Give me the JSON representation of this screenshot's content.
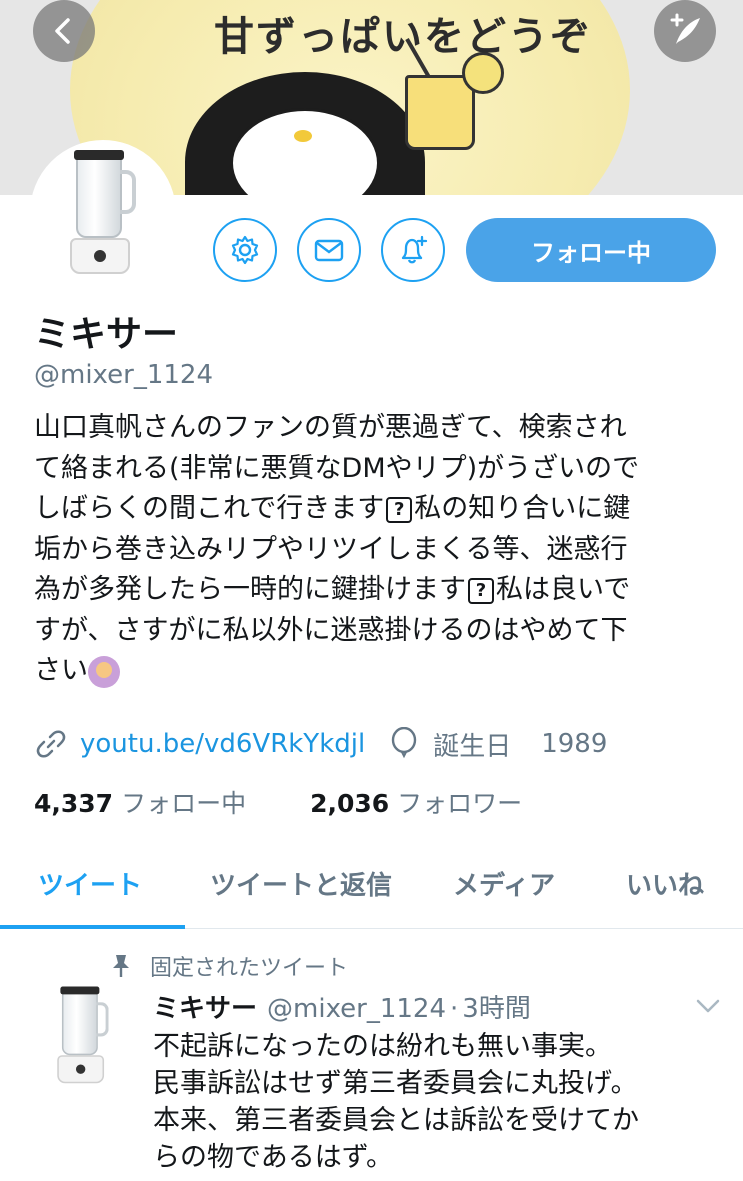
{
  "header": {
    "banner_text": "甘ずっぱいをどうぞ",
    "back_icon": "chevron-left-icon",
    "compose_icon": "feather-plus-icon"
  },
  "profile": {
    "name": "ミキサー",
    "handle": "@mixer_1124",
    "bio_lines": [
      "山口真帆さんのファンの質が悪過ぎて、検索され",
      "て絡まれる(非常に悪質なDMやリプ)がうざいので",
      "しばらくの間これで行きます",
      "私の知り合いに鍵",
      "垢から巻き込みリプやリツイしまくる等、迷惑行",
      "為が多発したら一時的に鍵掛けます",
      "私は良いで",
      "すが、さすがに私以外に迷惑掛けるのはやめて下",
      "さい"
    ],
    "emoji_box": "?",
    "url": "youtu.be/vd6VRkYkdjl",
    "birthday_label": "誕生日",
    "birthday_value": "1989",
    "following_count": "4,337",
    "following_label": "フォロー中",
    "followers_count": "2,036",
    "followers_label": "フォロワー"
  },
  "actions": {
    "settings_icon": "gear-icon",
    "dm_icon": "envelope-icon",
    "notify_icon": "bell-plus-icon",
    "follow_label": "フォロー中"
  },
  "tabs": [
    {
      "label": "ツイート",
      "active": true
    },
    {
      "label": "ツイートと返信",
      "active": false
    },
    {
      "label": "メディア",
      "active": false
    },
    {
      "label": "いいね",
      "active": false
    }
  ],
  "pinned_tweet": {
    "pinned_label": "固定されたツイート",
    "name": "ミキサー",
    "handle": "@mixer_1124",
    "separator": "·",
    "time": "3時間",
    "lines": [
      "不起訴になったのは紛れも無い事実。",
      "民事訴訟はせず第三者委員会に丸投げ。",
      "本来、第三者委員会とは訴訟を受けてか",
      "らの物であるはず。"
    ]
  },
  "colors": {
    "accent": "#1da1f2",
    "follow_button": "#4aa3e8",
    "secondary_text": "#657786"
  }
}
